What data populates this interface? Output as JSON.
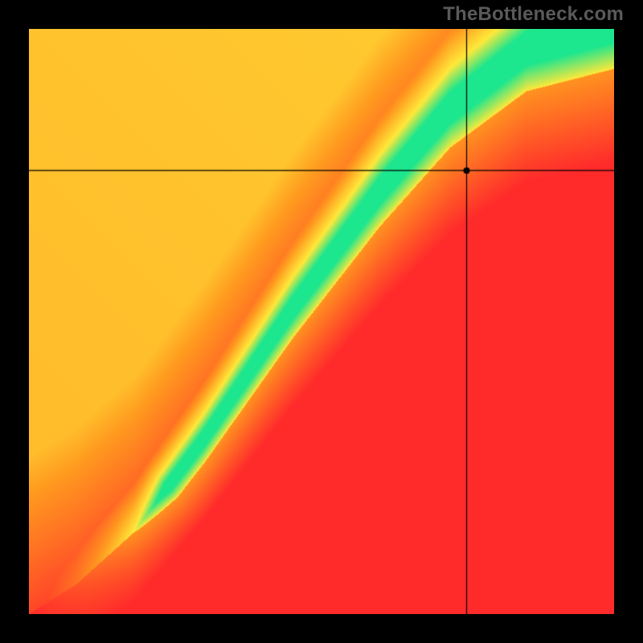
{
  "watermark": "TheBottleneck.com",
  "chart_data": {
    "type": "heatmap",
    "title": "",
    "xlabel": "",
    "ylabel": "",
    "xlim": [
      0,
      1
    ],
    "ylim": [
      0,
      1
    ],
    "crosshair": {
      "x": 0.748,
      "y": 0.758
    },
    "marker": {
      "x": 0.748,
      "y": 0.758,
      "radius": 4
    },
    "colorscale": {
      "description": "red-orange-yellow-green-yellow-orange-red traffic-light band around optimal ratio",
      "stops": [
        {
          "t": 0.0,
          "color": "#ff2b2b"
        },
        {
          "t": 0.45,
          "color": "#ff9a1f"
        },
        {
          "t": 0.7,
          "color": "#ffe83a"
        },
        {
          "t": 0.9,
          "color": "#1ce68e"
        },
        {
          "t": 1.0,
          "color": "#1ce68e"
        }
      ]
    },
    "ridge": {
      "description": "Center of green band, y as function of x (normalized). Piecewise linear approximation.",
      "points": [
        {
          "x": 0.0,
          "y": 0.0
        },
        {
          "x": 0.08,
          "y": 0.05
        },
        {
          "x": 0.18,
          "y": 0.14
        },
        {
          "x": 0.3,
          "y": 0.3
        },
        {
          "x": 0.45,
          "y": 0.52
        },
        {
          "x": 0.6,
          "y": 0.72
        },
        {
          "x": 0.72,
          "y": 0.86
        },
        {
          "x": 0.85,
          "y": 0.96
        },
        {
          "x": 1.0,
          "y": 1.0
        }
      ],
      "half_width": 0.055,
      "widen_with_y": 0.07
    },
    "background_corners": {
      "top_left": "#ff2b2b",
      "top_right": "#ffe83a",
      "bottom_left": "#ff2b2b",
      "bottom_right": "#ff2b2b"
    }
  }
}
